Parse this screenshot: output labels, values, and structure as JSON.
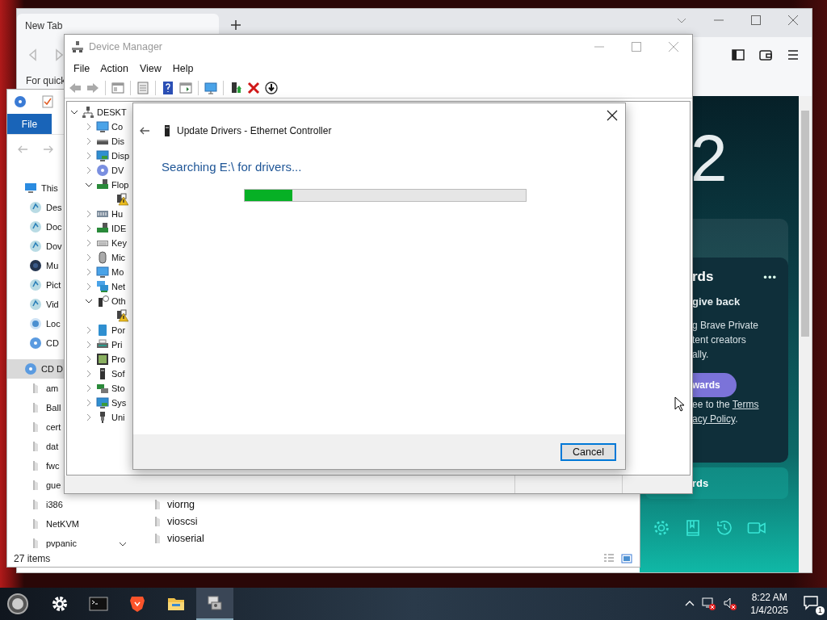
{
  "browser": {
    "tab": {
      "title": "New Tab",
      "selected": true
    },
    "hint": "For quick",
    "new_tab": {
      "clock": "2",
      "rewards_card": {
        "title": "rds",
        "menu": "•••",
        "subtitle": "give back",
        "body": [
          "g Brave Private",
          "tent creators",
          "ally."
        ],
        "button": "wards",
        "terms_before": "ee to the ",
        "terms_link": "Terms",
        "policy_link": "acy Policy",
        "policy_after": "."
      },
      "second_card": {
        "title": "rds"
      }
    }
  },
  "explorer": {
    "ribbon_tab": "File",
    "nav": [
      {
        "label": "This",
        "kind": "pc",
        "selected": false,
        "children": [
          {
            "label": "Des",
            "kind": "library",
            "selected": false
          },
          {
            "label": "Doc",
            "kind": "library",
            "selected": false
          },
          {
            "label": "Dov",
            "kind": "library",
            "selected": false
          },
          {
            "label": "Mu",
            "kind": "music",
            "selected": false
          },
          {
            "label": "Pict",
            "kind": "library",
            "selected": false
          },
          {
            "label": "Vid",
            "kind": "library",
            "selected": false
          },
          {
            "label": "Loc",
            "kind": "drive",
            "selected": false
          },
          {
            "label": "CD",
            "kind": "disc",
            "selected": false
          }
        ]
      },
      {
        "label": "CD D",
        "kind": "disc",
        "selected": true,
        "children": [
          {
            "label": "am",
            "kind": "folder",
            "selected": false
          },
          {
            "label": "Ball",
            "kind": "folder",
            "selected": false
          },
          {
            "label": "cert",
            "kind": "folder",
            "selected": false
          },
          {
            "label": "dat",
            "kind": "folder",
            "selected": false
          },
          {
            "label": "fwc",
            "kind": "folder",
            "selected": false
          },
          {
            "label": "gue",
            "kind": "folder",
            "selected": false
          },
          {
            "label": "i386",
            "kind": "folder",
            "selected": false
          },
          {
            "label": "NetKVM",
            "kind": "folder",
            "selected": false
          },
          {
            "label": "pvpanic",
            "kind": "folder",
            "selected": false
          }
        ]
      }
    ],
    "files": [
      "viorng",
      "vioscsi",
      "vioserial"
    ],
    "status": "27 items"
  },
  "device_manager": {
    "title": "Device Manager",
    "menu": [
      "File",
      "Action",
      "View",
      "Help"
    ],
    "tree": {
      "label": "DESKT",
      "kind": "computer",
      "expanded": true,
      "children": [
        {
          "label": "Co",
          "kind": "monitor",
          "expanded": false
        },
        {
          "label": "Dis",
          "kind": "drive",
          "expanded": false
        },
        {
          "label": "Disp",
          "kind": "display",
          "expanded": false
        },
        {
          "label": "DV",
          "kind": "disc",
          "expanded": false
        },
        {
          "label": "Flop",
          "kind": "card",
          "expanded": true,
          "children": [
            {
              "kind": "warning"
            }
          ]
        },
        {
          "label": "Hu",
          "kind": "hid",
          "expanded": false
        },
        {
          "label": "IDE",
          "kind": "card",
          "expanded": false
        },
        {
          "label": "Key",
          "kind": "keyboard",
          "expanded": false
        },
        {
          "label": "Mic",
          "kind": "mouse",
          "expanded": false
        },
        {
          "label": "Mo",
          "kind": "monitor",
          "expanded": false
        },
        {
          "label": "Net",
          "kind": "network",
          "expanded": false
        },
        {
          "label": "Oth",
          "kind": "unknown",
          "expanded": true,
          "children": [
            {
              "kind": "warning"
            }
          ]
        },
        {
          "label": "Por",
          "kind": "port",
          "expanded": false
        },
        {
          "label": "Pri",
          "kind": "printer",
          "expanded": false
        },
        {
          "label": "Pro",
          "kind": "chip",
          "expanded": false
        },
        {
          "label": "Sof",
          "kind": "device",
          "expanded": false
        },
        {
          "label": "Sto",
          "kind": "storage",
          "expanded": false
        },
        {
          "label": "Sys",
          "kind": "display",
          "expanded": false
        },
        {
          "label": "Uni",
          "kind": "usb",
          "expanded": false
        }
      ]
    }
  },
  "dialog": {
    "title": "Update Drivers - Ethernet Controller",
    "status": "Searching E:\\ for drivers...",
    "progress": {
      "level": 0.17
    },
    "cancel": "Cancel"
  },
  "taskbar": {
    "apps": [
      {
        "kind": "settings",
        "selected": false
      },
      {
        "kind": "terminal",
        "selected": false
      },
      {
        "kind": "brave",
        "selected": false
      },
      {
        "kind": "explorer",
        "selected": false
      },
      {
        "kind": "device-manager",
        "selected": true
      }
    ],
    "time": "8:22 AM",
    "date": "1/4/2025",
    "notifications": "1"
  }
}
